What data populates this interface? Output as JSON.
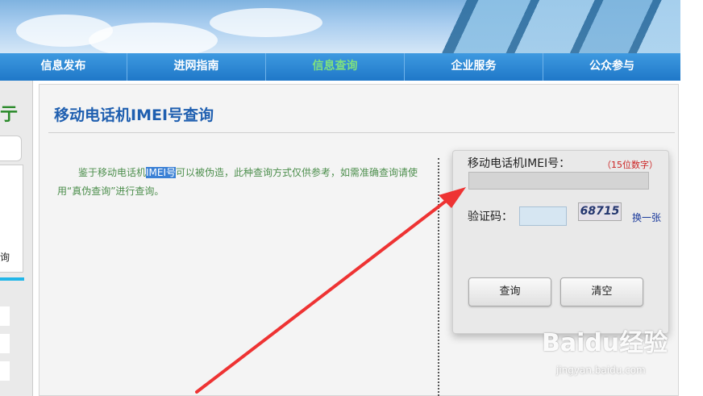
{
  "nav": {
    "items": [
      {
        "label": "信息发布",
        "active": false
      },
      {
        "label": "进网指南",
        "active": false
      },
      {
        "label": "信息查询",
        "active": true
      },
      {
        "label": "企业服务",
        "active": false
      },
      {
        "label": "公众参与",
        "active": false
      }
    ]
  },
  "left_fragment": {
    "text_top": "亍",
    "text_query": "查询"
  },
  "page": {
    "title": "移动电话机IMEI号查询"
  },
  "description": {
    "part1": "鉴于移动电话机",
    "highlight": "IMEI号",
    "part2": "可以被伪造，此种查询方式仅供参考，如需准确查询请使用“真伪查询”进行查询。"
  },
  "form": {
    "imei_label": "移动电话机IMEI号：",
    "imei_hint": "（15位数字）",
    "imei_value": "",
    "code_label": "验证码：",
    "code_value": "",
    "captcha_text": "68715",
    "refresh_label": "换一张",
    "query_button": "查询",
    "clear_button": "清空"
  },
  "watermark": {
    "logo": "Baidu经验",
    "url": "jingyan.baidu.com"
  },
  "colors": {
    "nav_bg": "#1f78c8",
    "nav_active": "#7fe07f",
    "title": "#1f5fb0",
    "desc_text": "#4c8e4c",
    "arrow": "#ee3333"
  }
}
